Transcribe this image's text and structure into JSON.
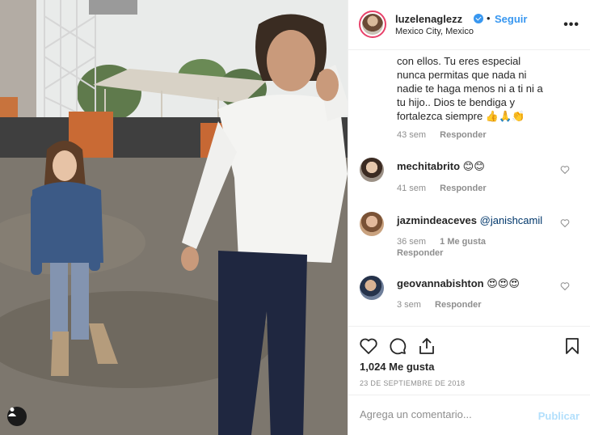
{
  "header": {
    "username": "luzelenaglezz",
    "separator": "•",
    "follow_label": "Seguir",
    "location": "Mexico City, Mexico",
    "more_icon": "more-dots-icon",
    "more_glyph": "•••"
  },
  "comments": [
    {
      "username": "",
      "text_lines": [
        "con ellos. Tu eres especial",
        "nunca permitas que nada ni",
        "nadie te haga menos ni a ti ni a",
        "tu hijo.. Dios te bendiga y",
        "fortalezca siempre 👍🙏👏"
      ],
      "time": "43 sem",
      "reply_label": "Responder"
    },
    {
      "username": "mechitabrito",
      "text": "😊😊",
      "time": "41 sem",
      "reply_label": "Responder"
    },
    {
      "username": "jazmindeaceves",
      "text": "@janishcamil",
      "time": "36 sem",
      "likes": "1 Me gusta",
      "reply_label": "Responder"
    },
    {
      "username": "geovannabishton",
      "text": "😍😍😍",
      "time": "3 sem",
      "reply_label": "Responder"
    }
  ],
  "actions": {
    "like_icon": "heart-icon",
    "comment_icon": "comment-icon",
    "share_icon": "share-icon",
    "save_icon": "bookmark-icon",
    "likes_count": "1,024 Me gusta",
    "date": "23 DE SEPTIEMBRE DE 2018"
  },
  "add_comment": {
    "placeholder": "Agrega un comentario...",
    "publish_label": "Publicar"
  },
  "colors": {
    "accent": "#3897f0",
    "publish_disabled": "#b2dffc",
    "muted": "#8e8e8e",
    "border": "#efefef"
  }
}
